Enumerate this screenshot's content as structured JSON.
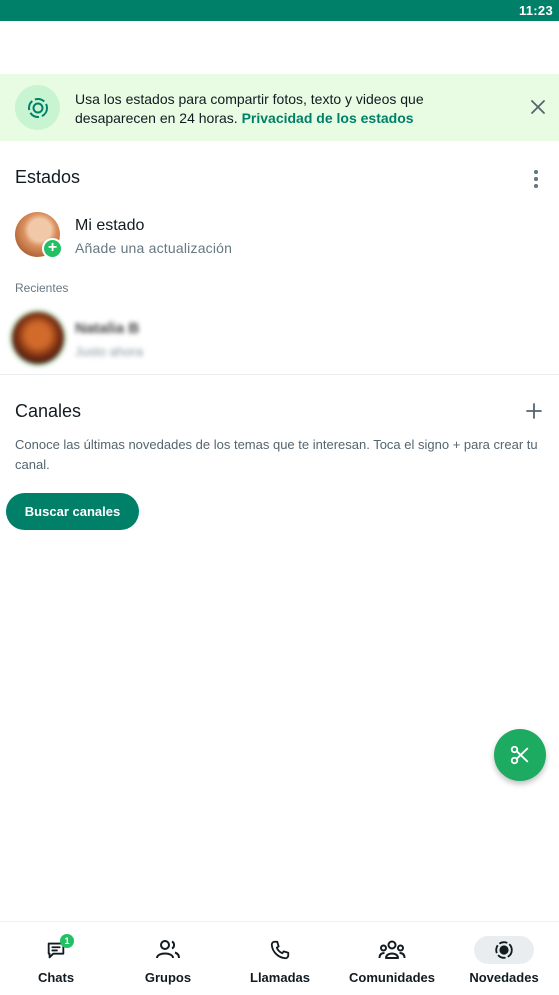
{
  "status_bar": {
    "time": "11:23"
  },
  "banner": {
    "text": "Usa los estados para compartir fotos, texto y videos que desaparecen en 24 horas.",
    "link": "Privacidad de los estados",
    "icon": "status-ring-icon",
    "close_icon": "close-icon"
  },
  "estados": {
    "title": "Estados",
    "menu_icon": "more-vert-icon",
    "my_status": {
      "name": "Mi estado",
      "subtitle": "Añade una actualización"
    },
    "recientes_label": "Recientes",
    "recent": [
      {
        "name": "Natalia B",
        "time": "Justo ahora"
      }
    ]
  },
  "canales": {
    "title": "Canales",
    "add_icon": "plus-icon",
    "description": "Conoce las últimas novedades de los temas que te interesan. Toca el signo + para crear tu canal.",
    "button": "Buscar canales"
  },
  "fab": {
    "icon": "scissors-icon"
  },
  "nav": {
    "items": [
      {
        "label": "Chats",
        "icon": "chats-icon",
        "badge": "1"
      },
      {
        "label": "Grupos",
        "icon": "groups-icon"
      },
      {
        "label": "Llamadas",
        "icon": "phone-icon"
      },
      {
        "label": "Comunidades",
        "icon": "communities-icon"
      },
      {
        "label": "Novedades",
        "icon": "updates-icon",
        "active": true
      }
    ]
  },
  "colors": {
    "brand": "#008069",
    "accent": "#21c063",
    "banner_bg": "#e7fce3"
  }
}
